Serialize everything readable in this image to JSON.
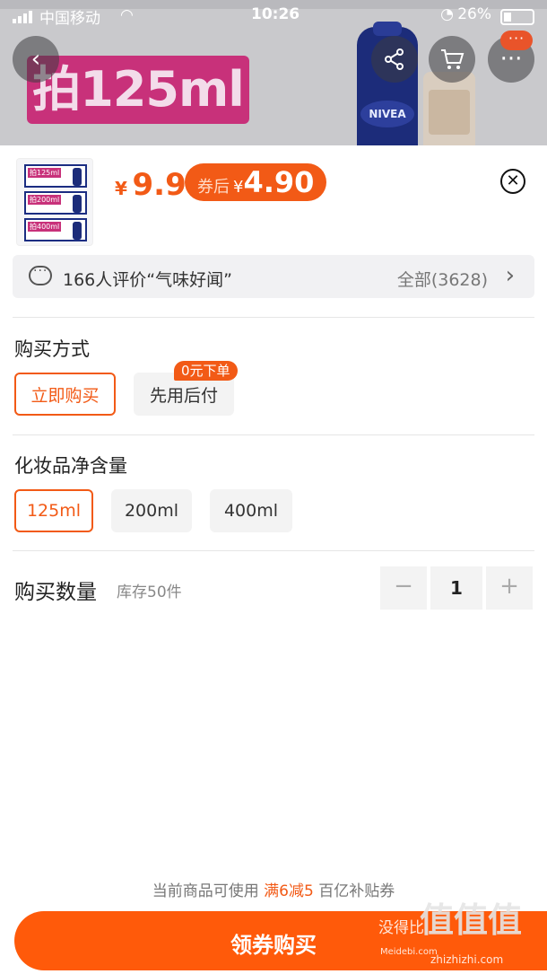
{
  "status_bar": {
    "carrier": "中国移动",
    "time": "10:26",
    "battery": "26%"
  },
  "background": {
    "promo_text": "拍125ml",
    "brand_text": "NIVEA",
    "more_badge": "···"
  },
  "product": {
    "price_currency": "¥",
    "price": "9.9",
    "coupon_tag": "券后",
    "coupon_currency": "¥",
    "coupon_price": "4.90",
    "thumb_labels": [
      "拍125ml",
      "拍200ml",
      "拍400ml"
    ]
  },
  "reviews": {
    "summary": "166人评价“气味好闻”",
    "all_label": "全部(3628)"
  },
  "purchase_method": {
    "title": "购买方式",
    "options": [
      "立即购买",
      "先用后付"
    ],
    "badge": "0元下单"
  },
  "volume": {
    "title": "化妆品净含量",
    "options": [
      "125ml",
      "200ml",
      "400ml"
    ]
  },
  "quantity": {
    "title": "购买数量",
    "stock": "库存50件",
    "value": "1",
    "minus": "−",
    "plus": "+"
  },
  "footer": {
    "note_prefix": "当前商品可使用",
    "note_highlight": "满6减5",
    "note_suffix": "百亿补贴券",
    "buy_label": "领券购买",
    "watermark_text": "没得比",
    "watermark_sub": "Meidebi.com",
    "watermark_logo": "值值值",
    "watermark_site": "zhizhizhi.com"
  },
  "colors": {
    "accent": "#f25a16",
    "button": "#ff5a0a"
  }
}
